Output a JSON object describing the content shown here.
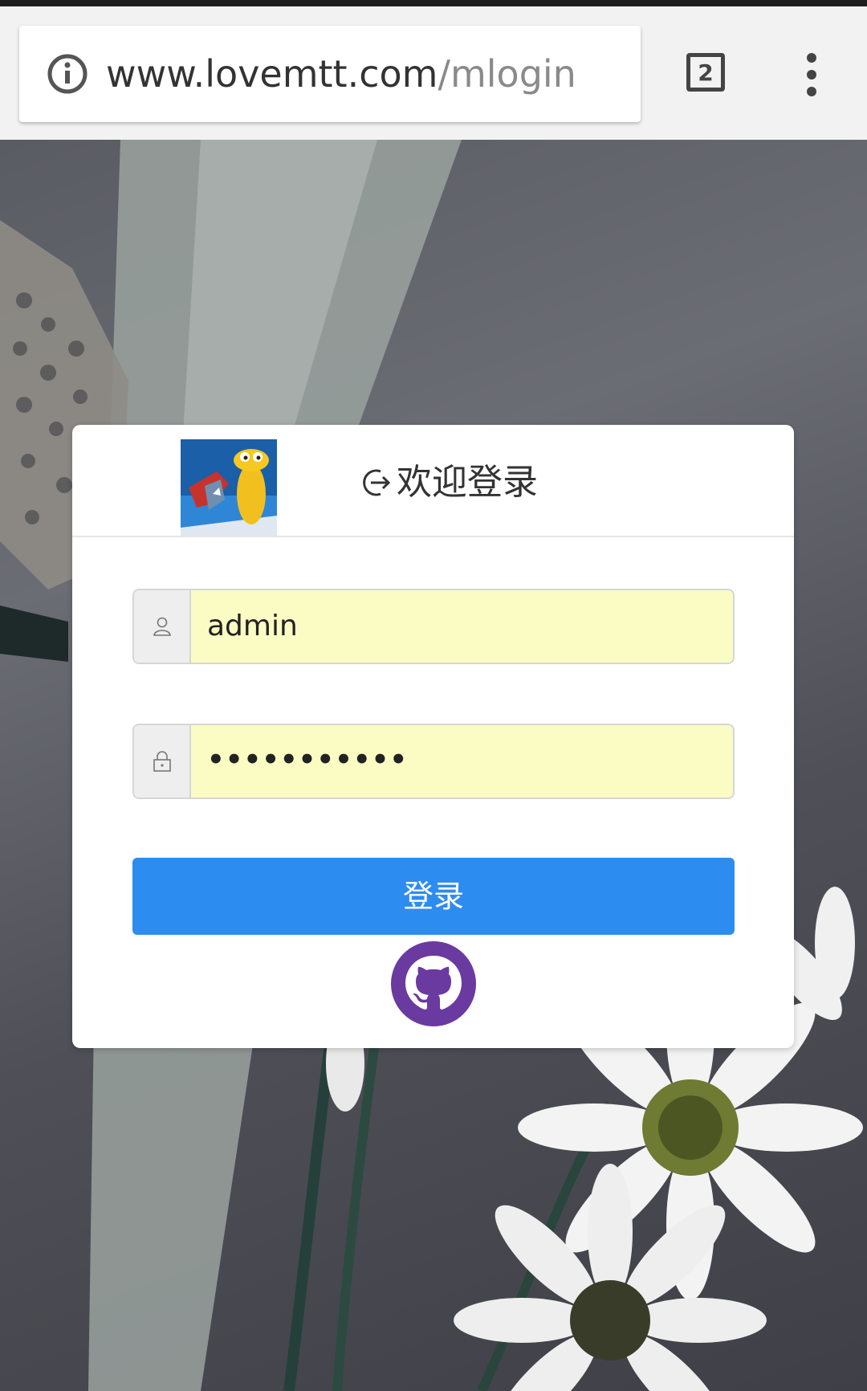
{
  "browser": {
    "url_domain": "www.lovemtt.com",
    "url_path": "/mlogin",
    "tab_count": "2",
    "icons": [
      "info-icon",
      "kebab-menu-icon"
    ]
  },
  "login": {
    "title": "欢迎登录",
    "username_value": "admin",
    "password_mask": "•••••••••••",
    "submit_label": "登录",
    "icons": [
      "login-arrow-icon",
      "user-icon",
      "lock-icon",
      "github-icon"
    ],
    "colors": {
      "button": "#2d8cf0",
      "field_bg": "#fbfcc4",
      "github": "#6a3aa0"
    }
  }
}
